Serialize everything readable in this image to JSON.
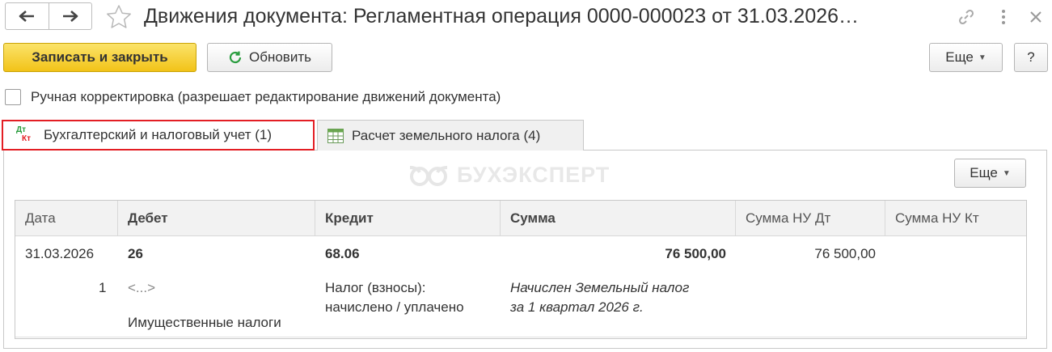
{
  "window": {
    "title": "Движения документа: Регламентная операция 0000-000023 от 31.03.2026…"
  },
  "toolbar": {
    "save_close_label": "Записать и закрыть",
    "refresh_label": "Обновить",
    "more_label": "Еще",
    "help_label": "?"
  },
  "manual_correction": {
    "label": "Ручная корректировка (разрешает редактирование движений документа)",
    "checked": false
  },
  "tabs": [
    {
      "label": "Бухгалтерский и налоговый учет (1)",
      "icon": "dt-kt-icon",
      "active": true
    },
    {
      "label": "Расчет земельного налога (4)",
      "icon": "table-icon",
      "active": false
    }
  ],
  "dtkt_icon": {
    "dt": "Дт",
    "kt": "Кт"
  },
  "watermark": "БУХЭКСПЕРТ",
  "panel": {
    "more_label": "Еще"
  },
  "table": {
    "columns": [
      "Дата",
      "Дебет",
      "Кредит",
      "Сумма",
      "Сумма НУ Дт",
      "Сумма НУ Кт"
    ],
    "row": {
      "date": "31.03.2026",
      "line_no": "1",
      "debit_account": "26",
      "debit_subconto1": "<...>",
      "debit_subconto2": "Имущественные налоги",
      "credit_account": "68.06",
      "credit_subconto": "Налог (взносы):\nначислено / уплачено",
      "credit_subconto_line1": "Налог (взносы):",
      "credit_subconto_line2": "начислено / уплачено",
      "amount": "76 500,00",
      "content_line1": "Начислен Земельный налог",
      "content_line2": "за 1 квартал 2026 г.",
      "amount_nu_dt": "76 500,00",
      "amount_nu_kt": ""
    }
  },
  "colors": {
    "primary_button": "#f2c318",
    "active_tab_border": "#e31e24",
    "dt_color": "#2a9d3f",
    "kt_color": "#e31e24"
  }
}
